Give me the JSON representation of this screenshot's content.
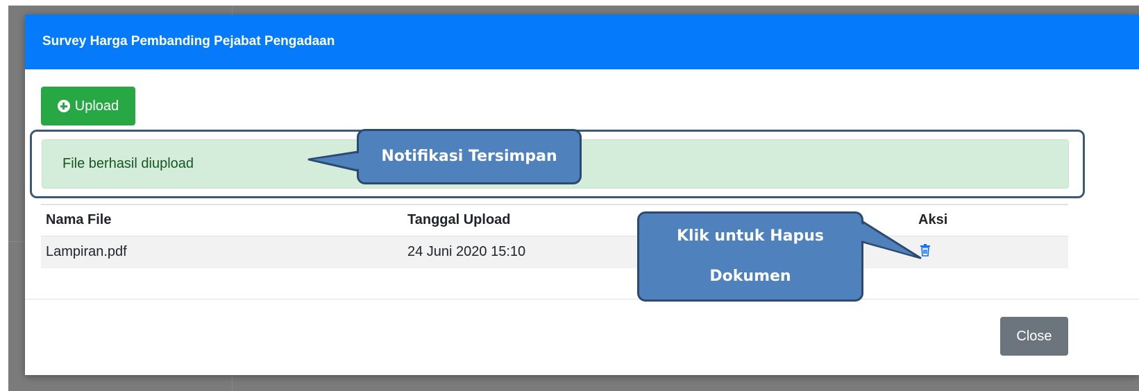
{
  "modal": {
    "title": "Survey Harga Pembanding Pejabat Pengadaan",
    "upload_label": "Upload",
    "alert_message": "File berhasil diupload",
    "close_label": "Close"
  },
  "table": {
    "columns": [
      "Nama File",
      "Tanggal Upload",
      "Aksi"
    ],
    "rows": [
      {
        "nama_file": "Lampiran.pdf",
        "tanggal_upload": "24 Juni 2020 15:10",
        "aksi_icon": "trash-icon"
      }
    ]
  },
  "annotations": {
    "notification_callout": "Notifikasi Tersimpan",
    "delete_callout_line1": "Klik untuk Hapus",
    "delete_callout_line2": "Dokumen"
  },
  "colors": {
    "header": "#057bfc",
    "upload_button": "#28a745",
    "alert_bg": "#d4edda",
    "alert_text": "#155724",
    "close_button": "#6c757d",
    "callout_fill": "#4f81bd",
    "callout_border": "#2c4a6e",
    "trash_icon": "#0d6efd"
  }
}
